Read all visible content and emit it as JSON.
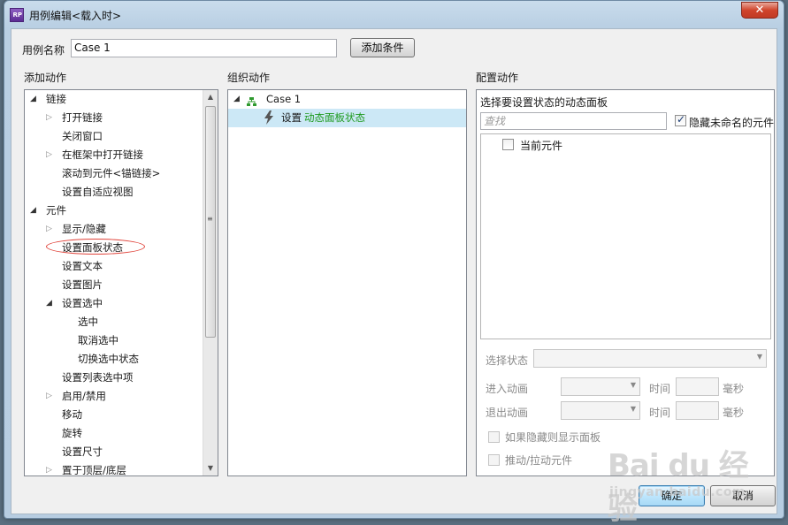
{
  "window": {
    "title": "用例编辑<载入时>",
    "close_symbol": "✕",
    "app_icon_text": "RP"
  },
  "case_name": {
    "label": "用例名称",
    "value": "Case 1",
    "add_condition_button": "添加条件"
  },
  "add_actions": {
    "header": "添加动作",
    "items": [
      {
        "label": "链接",
        "level": 0,
        "expand": "open"
      },
      {
        "label": "打开链接",
        "level": 1,
        "expand": "closed"
      },
      {
        "label": "关闭窗口",
        "level": 1,
        "expand": "none"
      },
      {
        "label": "在框架中打开链接",
        "level": 1,
        "expand": "closed"
      },
      {
        "label": "滚动到元件<锚链接>",
        "level": 1,
        "expand": "none"
      },
      {
        "label": "设置自适应视图",
        "level": 1,
        "expand": "none"
      },
      {
        "label": "元件",
        "level": 0,
        "expand": "open"
      },
      {
        "label": "显示/隐藏",
        "level": 1,
        "expand": "closed"
      },
      {
        "label": "设置面板状态",
        "level": 1,
        "expand": "none"
      },
      {
        "label": "设置文本",
        "level": 1,
        "expand": "none"
      },
      {
        "label": "设置图片",
        "level": 1,
        "expand": "none"
      },
      {
        "label": "设置选中",
        "level": 1,
        "expand": "open"
      },
      {
        "label": "选中",
        "level": 2,
        "expand": "none"
      },
      {
        "label": "取消选中",
        "level": 2,
        "expand": "none"
      },
      {
        "label": "切换选中状态",
        "level": 2,
        "expand": "none"
      },
      {
        "label": "设置列表选中项",
        "level": 1,
        "expand": "none"
      },
      {
        "label": "启用/禁用",
        "level": 1,
        "expand": "closed"
      },
      {
        "label": "移动",
        "level": 1,
        "expand": "none"
      },
      {
        "label": "旋转",
        "level": 1,
        "expand": "none"
      },
      {
        "label": "设置尺寸",
        "level": 1,
        "expand": "none"
      },
      {
        "label": "置于顶层/底层",
        "level": 1,
        "expand": "closed"
      }
    ]
  },
  "organize_actions": {
    "header": "组织动作",
    "case_label": "Case 1",
    "action_prefix": "设置",
    "action_target": "动态面板状态",
    "accent_color": "#1e9a1e"
  },
  "configure_actions": {
    "header": "配置动作",
    "subheader": "选择要设置状态的动态面板",
    "search_placeholder": "查找",
    "hide_unnamed_label": "隐藏未命名的元件",
    "hide_unnamed_checked": true,
    "current_widget_label": "当前元件",
    "select_state_label": "选择状态",
    "enter_anim_label": "进入动画",
    "exit_anim_label": "退出动画",
    "time_label": "时间",
    "ms_label": "毫秒",
    "show_if_hidden_label": "如果隐藏则显示面板",
    "push_pull_label": "推动/拉动元件"
  },
  "footer": {
    "ok_button": "确定",
    "cancel_button": "取消"
  },
  "watermark": {
    "brand": "Bai du 经验",
    "url": "jingyan.baidu.com"
  },
  "highlight_color": "#e0433a",
  "selection_color": "#cce8f6"
}
